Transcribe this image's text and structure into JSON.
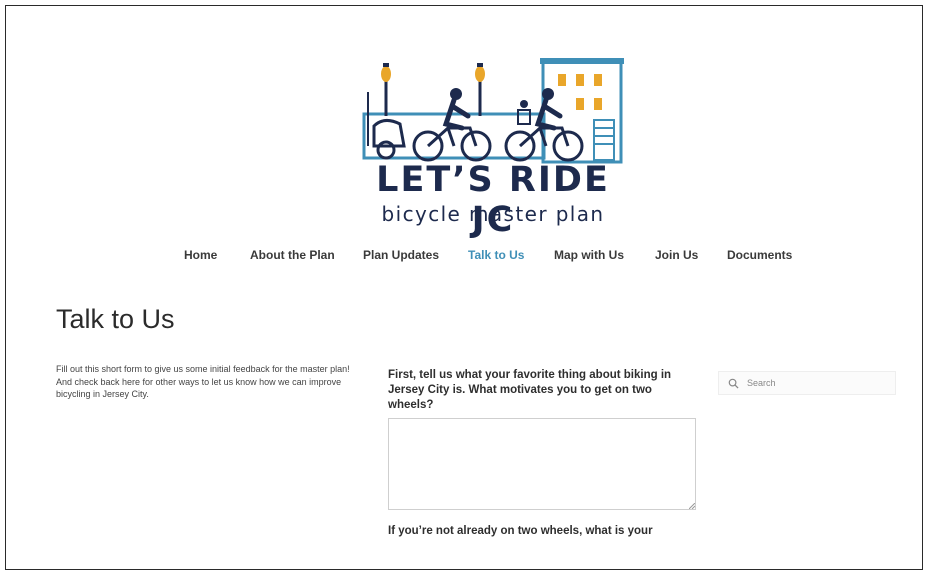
{
  "logo": {
    "title": "LET’S RIDE JC",
    "subtitle": "bicycle master plan",
    "colors": {
      "navy": "#1d2a4d",
      "blue": "#3f8fb7",
      "yellow": "#e9a62a"
    }
  },
  "nav": {
    "items": [
      {
        "label": "Home"
      },
      {
        "label": "About the Plan"
      },
      {
        "label": "Plan Updates"
      },
      {
        "label": "Talk to Us",
        "active": true
      },
      {
        "label": "Map with Us"
      },
      {
        "label": "Join Us"
      },
      {
        "label": "Documents"
      }
    ],
    "active_color": "#3f8fb7"
  },
  "page": {
    "title": "Talk to Us",
    "intro": "Fill out this short form to give us some initial feedback for the master plan! And check back here for other ways to let us know how we can improve bicycling in Jersey City."
  },
  "form": {
    "question1": "First, tell us what your favorite thing about biking in Jersey City is. What motivates you to get on two wheels?",
    "answer1": "",
    "question2": "If you’re not already on two wheels, what is your"
  },
  "sidebar": {
    "search_placeholder": "Search",
    "icon": "search-icon"
  }
}
